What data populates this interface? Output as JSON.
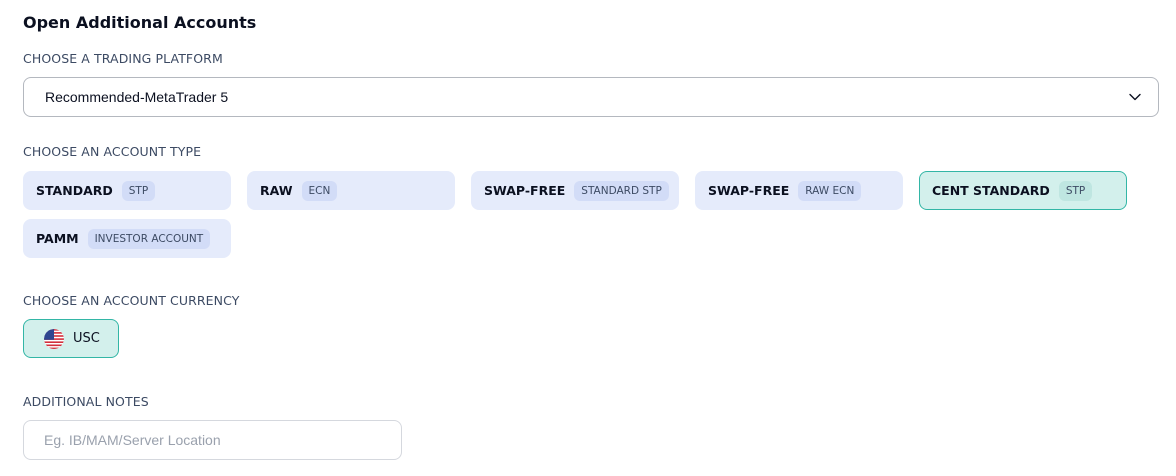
{
  "page": {
    "title": "Open Additional Accounts"
  },
  "platform": {
    "label": "CHOOSE A TRADING PLATFORM",
    "selected": "Recommended-MetaTrader 5"
  },
  "account_type": {
    "label": "CHOOSE AN ACCOUNT TYPE",
    "options": [
      {
        "name": "STANDARD",
        "tag": "STP",
        "selected": false
      },
      {
        "name": "RAW",
        "tag": "ECN",
        "selected": false
      },
      {
        "name": "SWAP-FREE",
        "tag": "STANDARD STP",
        "selected": false
      },
      {
        "name": "SWAP-FREE",
        "tag": "RAW ECN",
        "selected": false
      },
      {
        "name": "CENT STANDARD",
        "tag": "STP",
        "selected": true
      },
      {
        "name": "PAMM",
        "tag": "INVESTOR ACCOUNT",
        "selected": false
      }
    ]
  },
  "currency": {
    "label": "CHOOSE AN ACCOUNT CURRENCY",
    "selected": {
      "code": "USC",
      "icon": "us-flag-icon"
    }
  },
  "notes": {
    "label": "ADDITIONAL NOTES",
    "value": "",
    "placeholder": "Eg. IB/MAM/Server Location"
  },
  "colors": {
    "option_bg": "#e5ebfb",
    "selected_bg": "#d3f0ec",
    "selected_border": "#33b6a6"
  }
}
